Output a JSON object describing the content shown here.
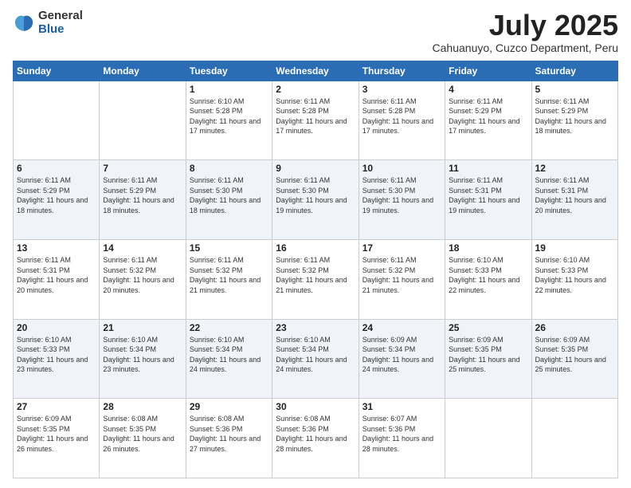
{
  "logo": {
    "general": "General",
    "blue": "Blue"
  },
  "header": {
    "month": "July 2025",
    "location": "Cahuanuyo, Cuzco Department, Peru"
  },
  "weekdays": [
    "Sunday",
    "Monday",
    "Tuesday",
    "Wednesday",
    "Thursday",
    "Friday",
    "Saturday"
  ],
  "weeks": [
    [
      {
        "day": "",
        "sunrise": "",
        "sunset": "",
        "daylight": ""
      },
      {
        "day": "",
        "sunrise": "",
        "sunset": "",
        "daylight": ""
      },
      {
        "day": "1",
        "sunrise": "Sunrise: 6:10 AM",
        "sunset": "Sunset: 5:28 PM",
        "daylight": "Daylight: 11 hours and 17 minutes."
      },
      {
        "day": "2",
        "sunrise": "Sunrise: 6:11 AM",
        "sunset": "Sunset: 5:28 PM",
        "daylight": "Daylight: 11 hours and 17 minutes."
      },
      {
        "day": "3",
        "sunrise": "Sunrise: 6:11 AM",
        "sunset": "Sunset: 5:28 PM",
        "daylight": "Daylight: 11 hours and 17 minutes."
      },
      {
        "day": "4",
        "sunrise": "Sunrise: 6:11 AM",
        "sunset": "Sunset: 5:29 PM",
        "daylight": "Daylight: 11 hours and 17 minutes."
      },
      {
        "day": "5",
        "sunrise": "Sunrise: 6:11 AM",
        "sunset": "Sunset: 5:29 PM",
        "daylight": "Daylight: 11 hours and 18 minutes."
      }
    ],
    [
      {
        "day": "6",
        "sunrise": "Sunrise: 6:11 AM",
        "sunset": "Sunset: 5:29 PM",
        "daylight": "Daylight: 11 hours and 18 minutes."
      },
      {
        "day": "7",
        "sunrise": "Sunrise: 6:11 AM",
        "sunset": "Sunset: 5:29 PM",
        "daylight": "Daylight: 11 hours and 18 minutes."
      },
      {
        "day": "8",
        "sunrise": "Sunrise: 6:11 AM",
        "sunset": "Sunset: 5:30 PM",
        "daylight": "Daylight: 11 hours and 18 minutes."
      },
      {
        "day": "9",
        "sunrise": "Sunrise: 6:11 AM",
        "sunset": "Sunset: 5:30 PM",
        "daylight": "Daylight: 11 hours and 19 minutes."
      },
      {
        "day": "10",
        "sunrise": "Sunrise: 6:11 AM",
        "sunset": "Sunset: 5:30 PM",
        "daylight": "Daylight: 11 hours and 19 minutes."
      },
      {
        "day": "11",
        "sunrise": "Sunrise: 6:11 AM",
        "sunset": "Sunset: 5:31 PM",
        "daylight": "Daylight: 11 hours and 19 minutes."
      },
      {
        "day": "12",
        "sunrise": "Sunrise: 6:11 AM",
        "sunset": "Sunset: 5:31 PM",
        "daylight": "Daylight: 11 hours and 20 minutes."
      }
    ],
    [
      {
        "day": "13",
        "sunrise": "Sunrise: 6:11 AM",
        "sunset": "Sunset: 5:31 PM",
        "daylight": "Daylight: 11 hours and 20 minutes."
      },
      {
        "day": "14",
        "sunrise": "Sunrise: 6:11 AM",
        "sunset": "Sunset: 5:32 PM",
        "daylight": "Daylight: 11 hours and 20 minutes."
      },
      {
        "day": "15",
        "sunrise": "Sunrise: 6:11 AM",
        "sunset": "Sunset: 5:32 PM",
        "daylight": "Daylight: 11 hours and 21 minutes."
      },
      {
        "day": "16",
        "sunrise": "Sunrise: 6:11 AM",
        "sunset": "Sunset: 5:32 PM",
        "daylight": "Daylight: 11 hours and 21 minutes."
      },
      {
        "day": "17",
        "sunrise": "Sunrise: 6:11 AM",
        "sunset": "Sunset: 5:32 PM",
        "daylight": "Daylight: 11 hours and 21 minutes."
      },
      {
        "day": "18",
        "sunrise": "Sunrise: 6:10 AM",
        "sunset": "Sunset: 5:33 PM",
        "daylight": "Daylight: 11 hours and 22 minutes."
      },
      {
        "day": "19",
        "sunrise": "Sunrise: 6:10 AM",
        "sunset": "Sunset: 5:33 PM",
        "daylight": "Daylight: 11 hours and 22 minutes."
      }
    ],
    [
      {
        "day": "20",
        "sunrise": "Sunrise: 6:10 AM",
        "sunset": "Sunset: 5:33 PM",
        "daylight": "Daylight: 11 hours and 23 minutes."
      },
      {
        "day": "21",
        "sunrise": "Sunrise: 6:10 AM",
        "sunset": "Sunset: 5:34 PM",
        "daylight": "Daylight: 11 hours and 23 minutes."
      },
      {
        "day": "22",
        "sunrise": "Sunrise: 6:10 AM",
        "sunset": "Sunset: 5:34 PM",
        "daylight": "Daylight: 11 hours and 24 minutes."
      },
      {
        "day": "23",
        "sunrise": "Sunrise: 6:10 AM",
        "sunset": "Sunset: 5:34 PM",
        "daylight": "Daylight: 11 hours and 24 minutes."
      },
      {
        "day": "24",
        "sunrise": "Sunrise: 6:09 AM",
        "sunset": "Sunset: 5:34 PM",
        "daylight": "Daylight: 11 hours and 24 minutes."
      },
      {
        "day": "25",
        "sunrise": "Sunrise: 6:09 AM",
        "sunset": "Sunset: 5:35 PM",
        "daylight": "Daylight: 11 hours and 25 minutes."
      },
      {
        "day": "26",
        "sunrise": "Sunrise: 6:09 AM",
        "sunset": "Sunset: 5:35 PM",
        "daylight": "Daylight: 11 hours and 25 minutes."
      }
    ],
    [
      {
        "day": "27",
        "sunrise": "Sunrise: 6:09 AM",
        "sunset": "Sunset: 5:35 PM",
        "daylight": "Daylight: 11 hours and 26 minutes."
      },
      {
        "day": "28",
        "sunrise": "Sunrise: 6:08 AM",
        "sunset": "Sunset: 5:35 PM",
        "daylight": "Daylight: 11 hours and 26 minutes."
      },
      {
        "day": "29",
        "sunrise": "Sunrise: 6:08 AM",
        "sunset": "Sunset: 5:36 PM",
        "daylight": "Daylight: 11 hours and 27 minutes."
      },
      {
        "day": "30",
        "sunrise": "Sunrise: 6:08 AM",
        "sunset": "Sunset: 5:36 PM",
        "daylight": "Daylight: 11 hours and 28 minutes."
      },
      {
        "day": "31",
        "sunrise": "Sunrise: 6:07 AM",
        "sunset": "Sunset: 5:36 PM",
        "daylight": "Daylight: 11 hours and 28 minutes."
      },
      {
        "day": "",
        "sunrise": "",
        "sunset": "",
        "daylight": ""
      },
      {
        "day": "",
        "sunrise": "",
        "sunset": "",
        "daylight": ""
      }
    ]
  ]
}
